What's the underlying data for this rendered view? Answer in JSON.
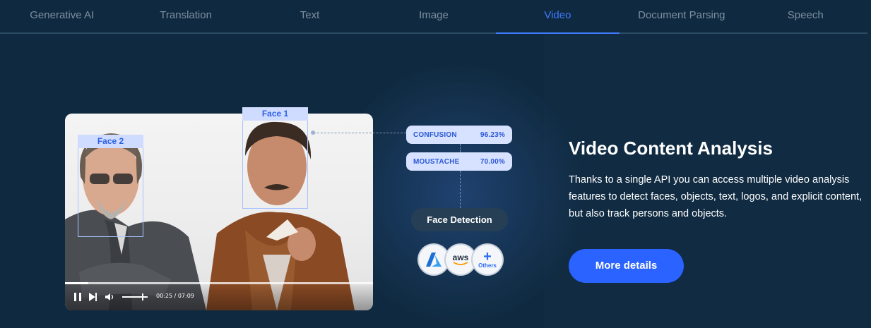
{
  "tabs": [
    {
      "label": "Generative AI",
      "active": false
    },
    {
      "label": "Translation",
      "active": false
    },
    {
      "label": "Text",
      "active": false
    },
    {
      "label": "Image",
      "active": false
    },
    {
      "label": "Video",
      "active": true
    },
    {
      "label": "Document Parsing",
      "active": false
    },
    {
      "label": "Speech",
      "active": false
    }
  ],
  "video": {
    "faces": [
      {
        "label": "Face 1"
      },
      {
        "label": "Face 2"
      }
    ],
    "timecode": "00:25 / 07:09",
    "progress": 0.075,
    "volume": 0.8
  },
  "tags": [
    {
      "name": "CONFUSION",
      "score": "96.23%"
    },
    {
      "name": "MOUSTACHE",
      "score": "70.00%"
    }
  ],
  "feature_pill": "Face Detection",
  "providers": [
    {
      "icon": "azure-logo",
      "label": ""
    },
    {
      "icon": "aws-logo",
      "label": "aws"
    },
    {
      "icon": "plus-icon",
      "label": "Others"
    }
  ],
  "content": {
    "title": "Video Content Analysis",
    "description": "Thanks to a single API you can access multiple video analysis features to detect faces, objects, text, logos, and explicit content, but also track persons and objects.",
    "button_label": "More details"
  },
  "colors": {
    "background": "#0f2a40",
    "accent": "#2a63ff",
    "tag_bg": "#d6e2ff",
    "tag_text": "#2c58d6"
  }
}
